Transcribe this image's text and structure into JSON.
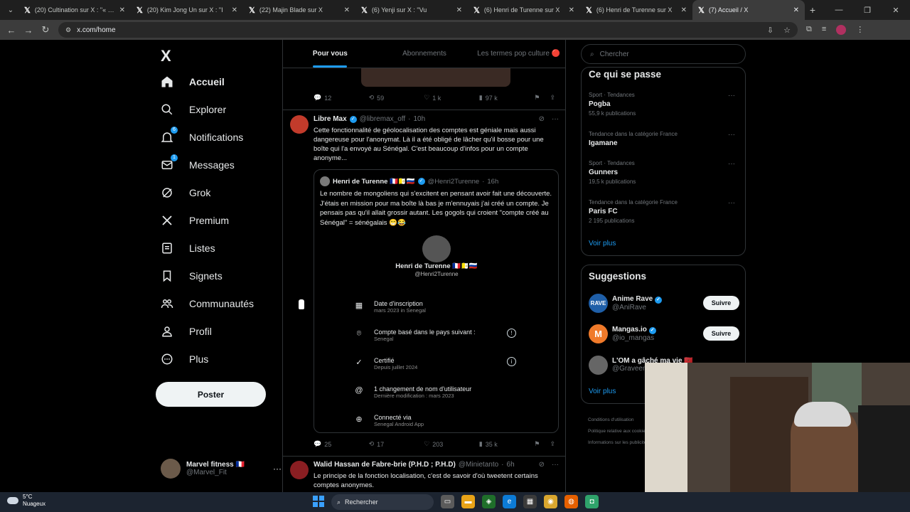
{
  "browser": {
    "tabs": [
      {
        "label": "(20) Cultination sur X : \"« C'est",
        "active": false
      },
      {
        "label": "(20) Kim Jong Un sur X : \"I",
        "active": false
      },
      {
        "label": "(22) Majin Blade sur X",
        "active": false
      },
      {
        "label": "(6) Yenji sur X : \"Vu",
        "active": false
      },
      {
        "label": "(6) Henri de Turenne sur X",
        "active": false
      },
      {
        "label": "(6) Henri de Turenne sur X",
        "active": false
      },
      {
        "label": "(7) Accueil / X",
        "active": true
      }
    ],
    "url": "x.com/home"
  },
  "sidebar": {
    "logo": "X",
    "items": [
      {
        "label": "Accueil",
        "icon": "home-icon",
        "badge": ""
      },
      {
        "label": "Explorer",
        "icon": "search-icon",
        "badge": ""
      },
      {
        "label": "Notifications",
        "icon": "bell-icon",
        "badge": "6"
      },
      {
        "label": "Messages",
        "icon": "mail-icon",
        "badge": "1"
      },
      {
        "label": "Grok",
        "icon": "grok-icon",
        "badge": ""
      },
      {
        "label": "Premium",
        "icon": "x-icon",
        "badge": ""
      },
      {
        "label": "Listes",
        "icon": "list-icon",
        "badge": ""
      },
      {
        "label": "Signets",
        "icon": "bookmark-icon",
        "badge": ""
      },
      {
        "label": "Communautés",
        "icon": "communities-icon",
        "badge": ""
      },
      {
        "label": "Profil",
        "icon": "profile-icon",
        "badge": ""
      },
      {
        "label": "Plus",
        "icon": "more-icon",
        "badge": ""
      }
    ],
    "post_label": "Poster",
    "account": {
      "name": "Marvel fitness 🇫🇷",
      "handle": "@Marvel_Fit"
    }
  },
  "feed": {
    "tabs": [
      "Pour vous",
      "Abonnements",
      "Les termes pop culture 🔴"
    ],
    "prev_actions": {
      "replies": "12",
      "reposts": "59",
      "likes": "1 k",
      "views": "97 k"
    },
    "tweet1": {
      "name": "Libre Max",
      "handle": "@libremax_off",
      "time": "10h",
      "text": "Cette fonctionnalité de géolocalisation des comptes est géniale mais aussi dangereuse pour l'anonymat. Là il a été obligé de lâcher qu'il bosse pour une boîte qui l'a envoyé au Sénégal. C'est beaucoup d'infos pour un compte anonyme...",
      "quote": {
        "name": "Henri de Turenne 🇫🇷🇻🇦🇷🇺",
        "handle": "@Henri2Turenne",
        "time": "16h",
        "text": "Le nombre de mongoliens qui s'excitent en pensant avoir fait une découverte. J'étais en mission pour ma boîte là bas je m'ennuyais j'ai créé un compte. Je pensais pas qu'il allait grossir autant. Les gogols qui croient \"compte créé au Sénégal\" = sénégalais 😁😂",
        "card": {
          "name": "Henri de Turenne 🇫🇷🇻🇦🇷🇺",
          "handle": "@Henri2Turenne",
          "rows": [
            {
              "title": "Date d'inscription",
              "sub": "mars 2023 in Senegal",
              "icon": "calendar-icon"
            },
            {
              "title": "Compte basé dans le pays suivant :",
              "sub": "Senegal",
              "icon": "location-icon"
            },
            {
              "title": "Certifié",
              "sub": "Depuis juillet 2024",
              "icon": "verified-icon"
            },
            {
              "title": "1 changement de nom d'utilisateur",
              "sub": "Dernière modification : mars 2023",
              "icon": "at-icon"
            },
            {
              "title": "Connecté via",
              "sub": "Senegal Android App",
              "icon": "globe-icon"
            }
          ]
        }
      },
      "actions": {
        "replies": "25",
        "reposts": "17",
        "likes": "203",
        "views": "35 k"
      }
    },
    "tweet2": {
      "name": "Walid Hassan de Fabre-brie (P.H.D ; P.H.D)",
      "handle": "@Minietanto",
      "time": "6h",
      "text": "Le principe de la fonction localisation, c'est de savoir d'où tweetent certains comptes anonymes."
    }
  },
  "right": {
    "search_placeholder": "Chercher",
    "trends_title": "Ce qui se passe",
    "trends": [
      {
        "category": "Sport · Tendances",
        "title": "Pogba",
        "count": "55,9 k publications"
      },
      {
        "category": "Tendance dans la catégorie France",
        "title": "Igamane",
        "count": ""
      },
      {
        "category": "Sport · Tendances",
        "title": "Gunners",
        "count": "19,5 k publications"
      },
      {
        "category": "Tendance dans la catégorie France",
        "title": "Paris FC",
        "count": "2 195 publications"
      }
    ],
    "show_more": "Voir plus",
    "suggestions_title": "Suggestions",
    "suggestions": [
      {
        "name": "Anime Rave",
        "handle": "@AniRave",
        "avatar_text": "RAVE",
        "color": "#1f5fa8"
      },
      {
        "name": "Mangas.io",
        "handle": "@io_mangas",
        "avatar_text": "M",
        "color": "#f07a2a"
      },
      {
        "name": "L'OM a gâché ma vie 🇲🇦",
        "handle": "@Graveen",
        "avatar_text": "",
        "color": "#666666"
      }
    ],
    "follow_label": "Suivre",
    "footer": [
      "Conditions d'utilisation",
      "Politique relative aux cookies",
      "Informations sur les publicités"
    ]
  },
  "taskbar": {
    "temp": "5°C",
    "weather": "Nuageux",
    "search": "Rechercher"
  },
  "colors": {
    "accent": "#1d9bf0",
    "bg": "#000000",
    "border": "#2f3336"
  }
}
